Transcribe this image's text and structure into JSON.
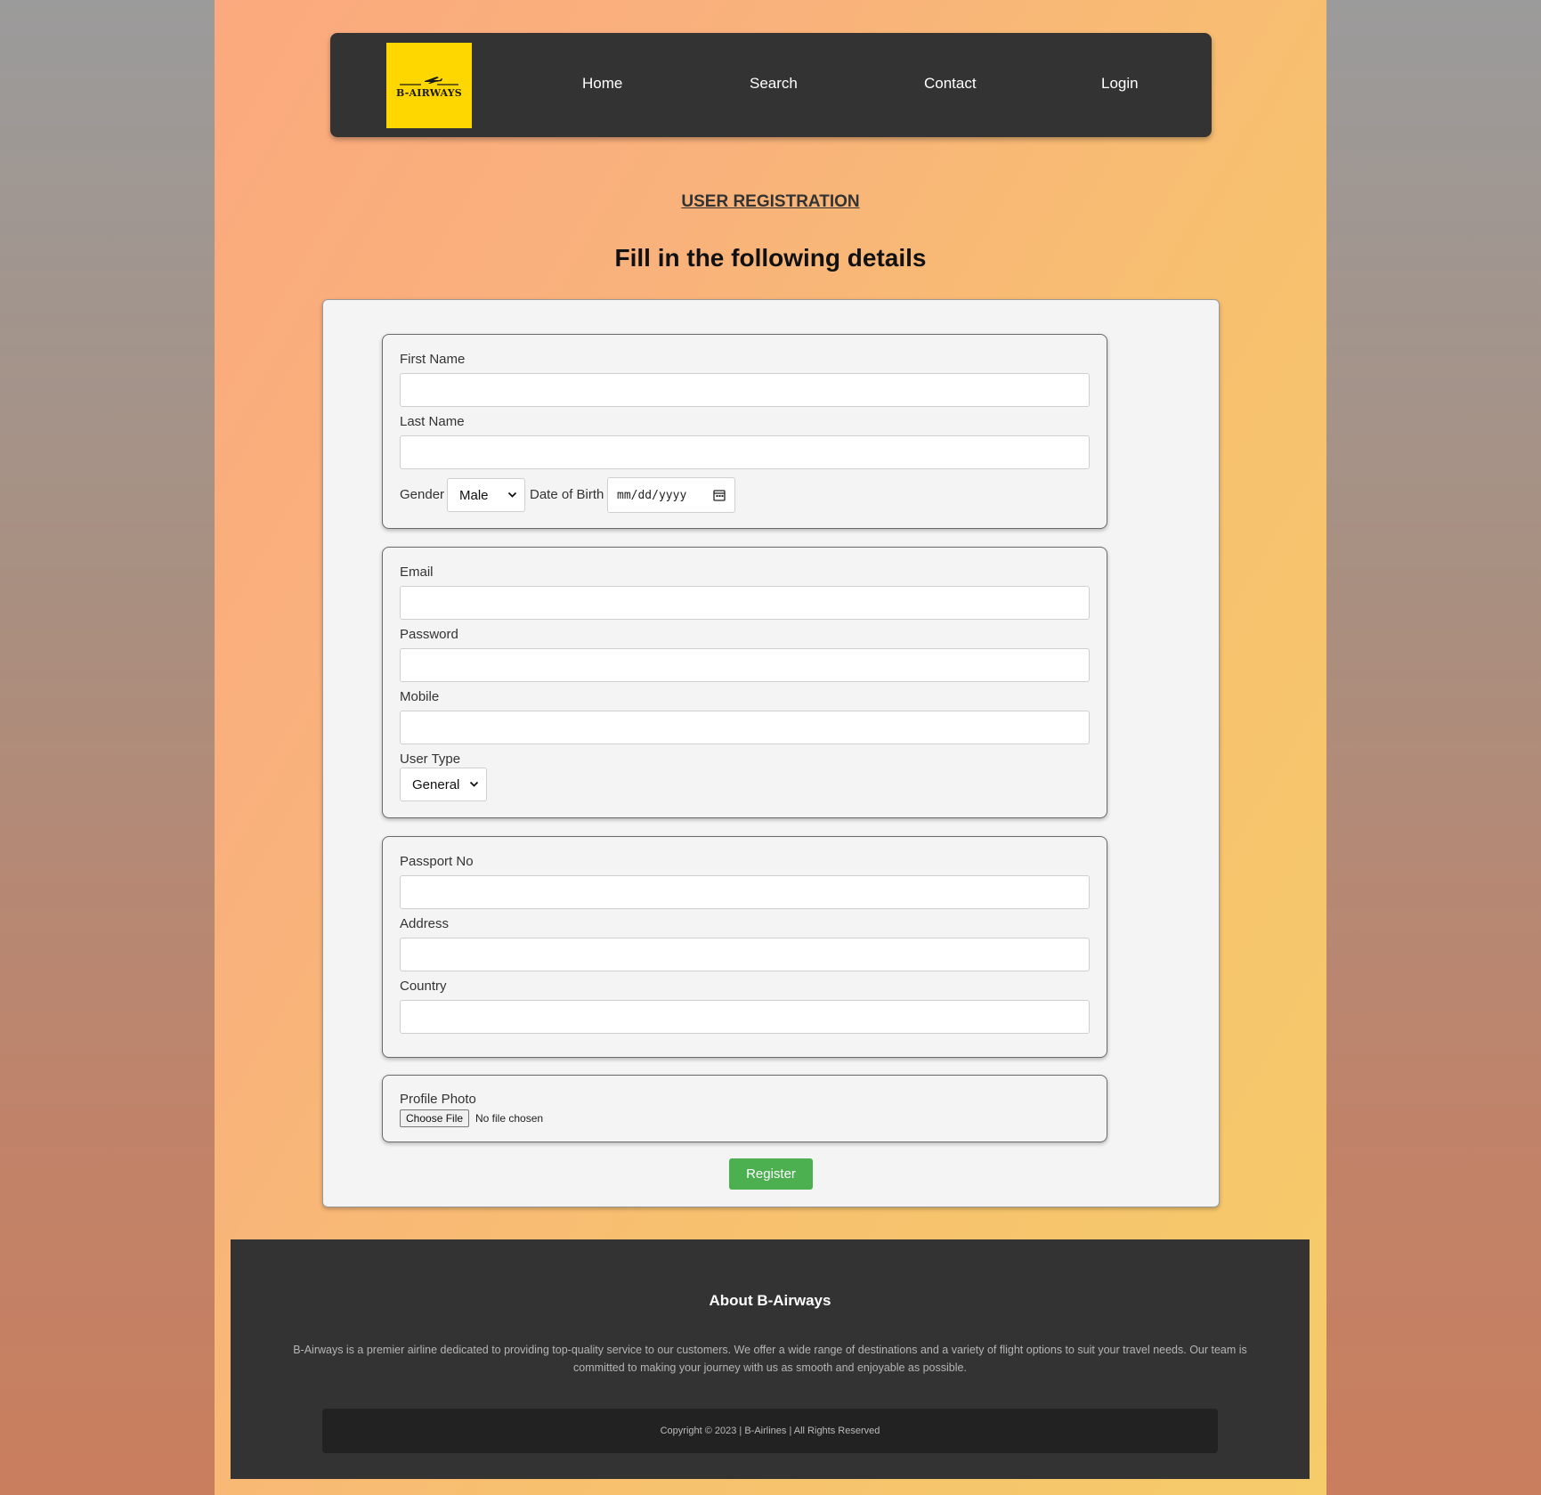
{
  "brand": {
    "logo_text": "B-AIRWAYS"
  },
  "nav": {
    "items": [
      "Home",
      "Search",
      "Contact",
      "Login"
    ]
  },
  "page": {
    "title": "USER REGISTRATION",
    "subtitle": "Fill in the following details"
  },
  "form": {
    "first_name_label": "First Name",
    "last_name_label": "Last Name",
    "gender_label": "Gender",
    "gender_value": "Male",
    "dob_label": "Date of Birth",
    "dob_placeholder": "mm/dd/yyyy",
    "email_label": "Email",
    "password_label": "Password",
    "mobile_label": "Mobile",
    "user_type_label": "User Type",
    "user_type_value": "General",
    "passport_label": "Passport No",
    "address_label": "Address",
    "country_label": "Country",
    "photo_label": "Profile Photo",
    "choose_file_label": "Choose File",
    "file_status": "No file chosen",
    "register_label": "Register"
  },
  "footer": {
    "title": "About B-Airways",
    "text": "B-Airways is a premier airline dedicated to providing top-quality service to our customers. We offer a wide range of destinations and a variety of flight options to suit your travel needs. Our team is committed to making your journey with us as smooth and enjoyable as possible.",
    "copyright": "Copyright © 2023 | B-Airlines | All Rights Reserved"
  },
  "colors": {
    "navbar": "#333333",
    "logo_bg": "#ffd700",
    "register_button": "#4caf50",
    "footer": "#333333"
  }
}
